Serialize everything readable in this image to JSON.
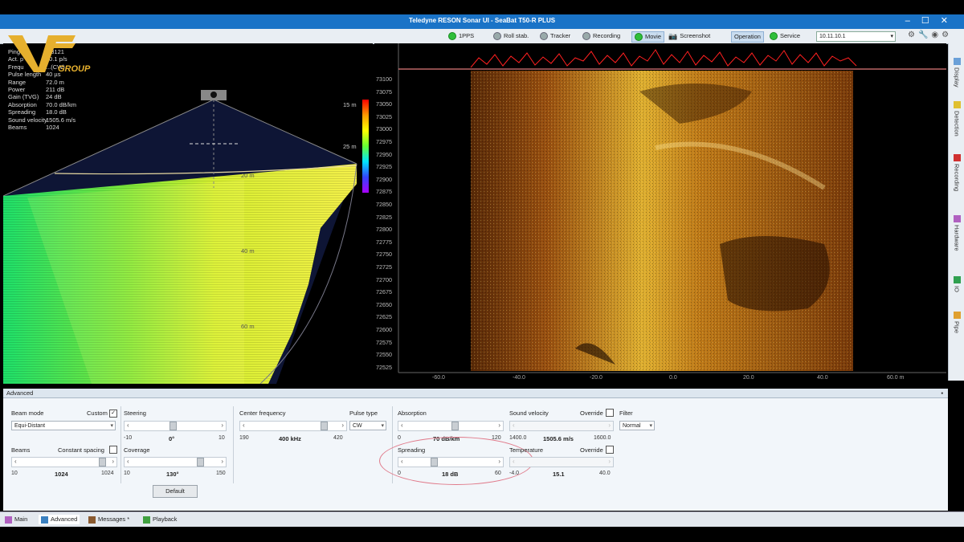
{
  "window": {
    "title": "Teledyne RESON Sonar UI - SeaBat T50-R PLUS"
  },
  "toolbar": {
    "items": [
      {
        "label": "1PPS",
        "status": "ok"
      },
      {
        "label": "Roll stab.",
        "status": "off"
      },
      {
        "label": "Tracker",
        "status": "off"
      },
      {
        "label": "Recording",
        "status": "off"
      },
      {
        "label": "Movie",
        "status": "ok"
      },
      {
        "label": "Screenshot",
        "status": "camera"
      },
      {
        "label": "Operation",
        "status": "active"
      },
      {
        "label": "Service",
        "status": "ok"
      }
    ],
    "ip": "10.11.10.1"
  },
  "logo": {
    "text": "GROUP"
  },
  "stats": [
    {
      "label": "Ping",
      "value": "...3121"
    },
    {
      "label": "Act. p",
      "value": "10.1 p/s"
    },
    {
      "label": "Frequ",
      "value": "...(CW)"
    },
    {
      "label": "Pulse length",
      "value": "40 µs"
    },
    {
      "label": "Range",
      "value": "72.0 m"
    },
    {
      "label": "Power",
      "value": "211 dB"
    },
    {
      "label": "Gain (TVG)",
      "value": "24 dB"
    },
    {
      "label": "Absorption",
      "value": "70.0 dB/km"
    },
    {
      "label": "Spreading",
      "value": "18.0 dB"
    },
    {
      "label": "Sound velocity",
      "value": "1505.6 m/s"
    },
    {
      "label": "Beams",
      "value": "1024"
    }
  ],
  "watercolumn": {
    "colorbar_labels": [
      "15 m",
      "25 m"
    ],
    "range_labels": [
      "20 m",
      "40 m",
      "60 m"
    ]
  },
  "sidescan": {
    "y_ticks": [
      "73100",
      "73075",
      "73050",
      "73025",
      "73000",
      "72975",
      "72950",
      "72925",
      "72900",
      "72875",
      "72850",
      "72825",
      "72800",
      "72775",
      "72750",
      "72725",
      "72700",
      "72675",
      "72650",
      "72625",
      "72600",
      "72575",
      "72550",
      "72525"
    ],
    "x_ticks": [
      "-60.0",
      "-40.0",
      "-20.0",
      "0.0",
      "20.0",
      "40.0",
      "60.0 m"
    ]
  },
  "sidetabs": [
    "Display",
    "Detection",
    "Recording",
    "Hardware",
    "IO",
    "Pipe"
  ],
  "advanced": {
    "header": "Advanced",
    "beam_mode": {
      "label": "Beam mode",
      "custom_label": "Custom",
      "value": "Equi-Distant"
    },
    "beams": {
      "label": "Beams",
      "constant_label": "Constant spacing",
      "min": "10",
      "value": "1024",
      "max": "1024"
    },
    "steering": {
      "label": "Steering",
      "min": "-10",
      "value": "0°",
      "max": "10"
    },
    "coverage": {
      "label": "Coverage",
      "min": "10",
      "value": "130°",
      "max": "150"
    },
    "default_button": "Default",
    "center_freq": {
      "label": "Center frequency",
      "min": "190",
      "value": "400 kHz",
      "max": "420"
    },
    "pulse_type": {
      "label": "Pulse type",
      "value": "CW"
    },
    "absorption": {
      "label": "Absorption",
      "min": "0",
      "value": "70 dB/km",
      "max": "120"
    },
    "spreading": {
      "label": "Spreading",
      "min": "0",
      "value": "18 dB",
      "max": "60"
    },
    "sound_velocity": {
      "label": "Sound velocity",
      "override_label": "Override",
      "min": "1400.0",
      "value": "1505.6 m/s",
      "max": "1600.0"
    },
    "temperature": {
      "label": "Temperature",
      "override_label": "Override",
      "min": "-4.0",
      "value": "15.1",
      "max": "40.0"
    },
    "filter": {
      "label": "Filter",
      "value": "Normal"
    }
  },
  "bottomtabs": [
    "Main",
    "Advanced",
    "Messages *",
    "Playback"
  ],
  "colors": {
    "titlebar": "#1a73c7",
    "status_ok": "#2fbf3a",
    "highlight": "#e07a8a"
  }
}
